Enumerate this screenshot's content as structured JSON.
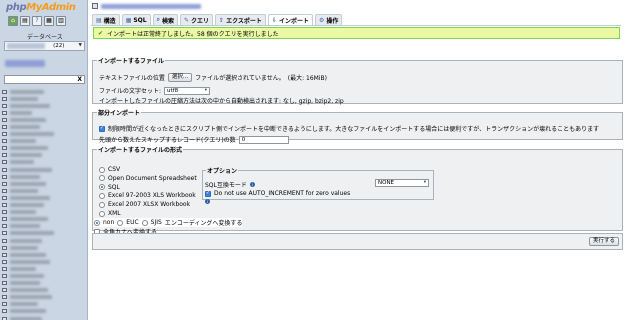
{
  "nav": {
    "logo_php": "php",
    "logo_myadmin": "MyAdmin",
    "icons": [
      "home-icon",
      "sql-window-icon",
      "query-icon",
      "docs-icon",
      "settings-icon"
    ],
    "db_label": "データベース",
    "db_select_count": "(22)",
    "filter_clear": "X"
  },
  "main": {
    "tabs": [
      {
        "label": "構造",
        "icon": "structure-icon"
      },
      {
        "label": "SQL",
        "icon": "sql-icon"
      },
      {
        "label": "検索",
        "icon": "search-icon"
      },
      {
        "label": "クエリ",
        "icon": "query-icon"
      },
      {
        "label": "エクスポート",
        "icon": "export-icon"
      },
      {
        "label": "インポート",
        "icon": "import-icon",
        "active": true
      },
      {
        "label": "操作",
        "icon": "operations-icon"
      }
    ],
    "notice": "インポートは正常終了しました。58 個のクエリを実行しました",
    "file_section": {
      "legend": "インポートするファイル",
      "file_location_label": "テキストファイルの位置",
      "browse_button": "選択...",
      "no_file_text": "ファイルが選択されていません。",
      "max_size": "(最大: 16MiB)",
      "charset_label": "ファイルの文字セット:",
      "charset_value": "utf8",
      "compression_note": "インポートしたファイルの圧縮方法は次の中から自動検出されます: なし, gzip, bzip2, zip"
    },
    "partial_section": {
      "legend": "部分インポート",
      "interrupt_label": "制限時間が近くなったときにスクリプト側でインポートを中断できるようにします。大きなファイルをインポートする場合には便利ですが、トランザクションが壊れることもあります",
      "skip_label": "先頭から数えたスキップするレコード(クエリ)の数",
      "skip_value": "0"
    },
    "format_section": {
      "legend": "インポートするファイルの形式",
      "formats": [
        {
          "label": "CSV",
          "selected": false
        },
        {
          "label": "Open Document Spreadsheet",
          "selected": false
        },
        {
          "label": "SQL",
          "selected": true
        },
        {
          "label": "Excel 97-2003 XLS Workbook",
          "selected": false
        },
        {
          "label": "Excel 2007 XLSX Workbook",
          "selected": false
        },
        {
          "label": "XML",
          "selected": false
        }
      ],
      "options_legend": "オプション",
      "sql_compat_label": "SQL互換モード",
      "sql_compat_value": "NONE",
      "auto_increment_label": "Do not use AUTO_INCREMENT for zero values"
    },
    "encoding": {
      "options": [
        "non",
        "EUC",
        "SJIS"
      ],
      "selected": "non",
      "convert_label": "エンコーディングへ変換する",
      "kana_label": "全角カナへ変換する"
    },
    "submit_button": "実行する"
  }
}
